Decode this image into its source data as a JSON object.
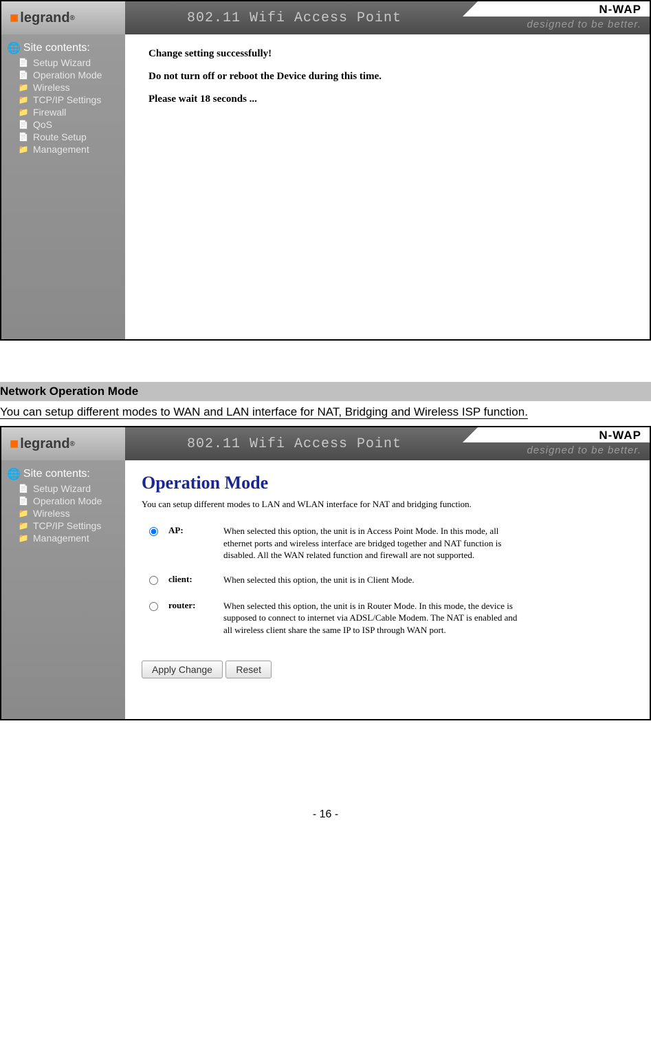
{
  "brand": {
    "logo_text": "legrand",
    "product": "N-WAP",
    "tagline": "designed to be better.",
    "header_title": "802.11 Wifi Access Point"
  },
  "sidebar": {
    "title": "Site contents:",
    "items_full": [
      {
        "label": "Setup Wizard",
        "type": "doc"
      },
      {
        "label": "Operation Mode",
        "type": "doc"
      },
      {
        "label": "Wireless",
        "type": "folder"
      },
      {
        "label": "TCP/IP Settings",
        "type": "folder"
      },
      {
        "label": "Firewall",
        "type": "folder"
      },
      {
        "label": "QoS",
        "type": "doc"
      },
      {
        "label": "Route Setup",
        "type": "doc"
      },
      {
        "label": "Management",
        "type": "folder"
      }
    ],
    "items_short": [
      {
        "label": "Setup Wizard",
        "type": "doc"
      },
      {
        "label": "Operation Mode",
        "type": "doc"
      },
      {
        "label": "Wireless",
        "type": "folder"
      },
      {
        "label": "TCP/IP Settings",
        "type": "folder"
      },
      {
        "label": "Management",
        "type": "folder"
      }
    ]
  },
  "panel1": {
    "msg1": "Change setting successfully!",
    "msg2": "Do not turn off or reboot the Device during this time.",
    "msg3": "Please wait 18 seconds ..."
  },
  "section": {
    "heading": "Network Operation Mode",
    "desc": "You can setup different modes to WAN and LAN interface for NAT, Bridging and Wireless ISP function."
  },
  "panel2": {
    "title": "Operation Mode",
    "desc": "You can setup different modes to LAN and WLAN interface for NAT and bridging function.",
    "options": [
      {
        "key": "AP:",
        "checked": true,
        "desc": "When selected this option, the unit is in Access Point Mode. In this mode, all ethernet ports and wireless interface are bridged together and NAT function is disabled. All the WAN related function and firewall are not supported."
      },
      {
        "key": "client:",
        "checked": false,
        "desc": "When selected this option, the unit is in Client Mode."
      },
      {
        "key": "router:",
        "checked": false,
        "desc": "When selected this option, the unit is in Router Mode. In this mode, the device is supposed to connect to internet via ADSL/Cable Modem. The NAT is enabled and all wireless client share the same IP to ISP through WAN port."
      }
    ],
    "buttons": {
      "apply": "Apply Change",
      "reset": "Reset"
    }
  },
  "footer": {
    "page": "- 16 -"
  }
}
